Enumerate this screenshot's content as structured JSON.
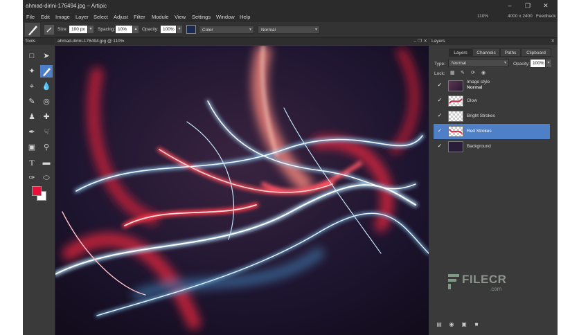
{
  "window": {
    "title": "ahmad-dirini-176494.jpg – Artipic",
    "zoom": "110%",
    "dimensions": "4000 x 2400",
    "feedback": "Feedback"
  },
  "menu": [
    "File",
    "Edit",
    "Image",
    "Layer",
    "Select",
    "Adjust",
    "Filter",
    "Module",
    "View",
    "Settings",
    "Window",
    "Help"
  ],
  "options": {
    "size_label": "Size:",
    "size_value": "100 px",
    "spacing_label": "Spacing:",
    "spacing_value": "10%",
    "opacity_label": "Opacity:",
    "opacity_value": "100%",
    "mode_value": "Color",
    "blend_value": "Normal"
  },
  "tools_panel": {
    "title": "Tools"
  },
  "document": {
    "tab": "ahmad-dirini-176494.jpg @ 110%"
  },
  "layers_panel": {
    "title": "Layers",
    "tabs": [
      "Layers",
      "Channels",
      "Paths",
      "Clipboard"
    ],
    "type_label": "Type:",
    "type_value": "Normal",
    "opacity_label": "Opacity:",
    "opacity_value": "100%",
    "lock_label": "Lock:",
    "layers": [
      {
        "name": "Image style",
        "sub": "Normal"
      },
      {
        "name": "Glow"
      },
      {
        "name": "Bright Strokes"
      },
      {
        "name": "Red Strokes"
      },
      {
        "name": "Background"
      }
    ]
  },
  "watermark": {
    "brand": "FILECR",
    "domain": ".com"
  },
  "colors": {
    "foreground": "#e8103a",
    "background": "#ffffff",
    "accent": "#4e7fc7"
  }
}
